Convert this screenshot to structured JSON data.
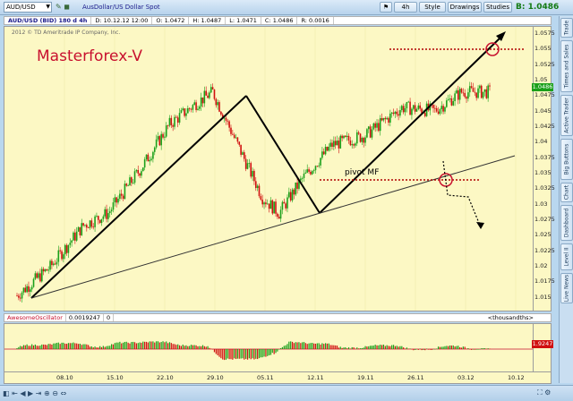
{
  "toolbar": {
    "symbol": "AUD/USD",
    "description": "AusDollar/US Dollar Spot",
    "period": "4h",
    "style": "Style",
    "drawings": "Drawings",
    "studies": "Studies",
    "bid": "B: 1.0486"
  },
  "chart_header": {
    "symbol_period": "AUD/USD (BID) 180 d 4h",
    "date": "D: 10.12.12 12:00",
    "open": "O: 1.0472",
    "high": "H: 1.0487",
    "low": "L: 1.0471",
    "close": "C: 1.0486",
    "range": "R: 0.0016"
  },
  "chart": {
    "watermark": "2012 © TD Ameritrade IP Company, Inc.",
    "title_annotation": "Masterforex-V",
    "pivot_label": "pivot MF",
    "last_price_label": "1.0486",
    "colors": {
      "up": "#1aa01a",
      "down": "#d01010",
      "accent_red": "#c8102e",
      "background": "#fcf8c4"
    }
  },
  "chart_data": {
    "type": "candlestick",
    "price_axis": [
      "1.0575",
      "1.055",
      "1.0525",
      "1.05",
      "1.0475",
      "1.045",
      "1.0425",
      "1.04",
      "1.0375",
      "1.035",
      "1.0325",
      "1.03",
      "1.0275",
      "1.025",
      "1.0225",
      "1.02",
      "1.0175",
      "1.015"
    ],
    "time_axis": [
      "08.10",
      "15.10",
      "22.10",
      "29.10",
      "05.11",
      "12.11",
      "19.11",
      "26.11",
      "03.12",
      "10.12"
    ],
    "ylim": [
      1.0125,
      1.0585
    ],
    "anchors": [
      {
        "x": 0,
        "y": 1.0152
      },
      {
        "x": 20,
        "y": 1.0198
      },
      {
        "x": 40,
        "y": 1.0265
      },
      {
        "x": 55,
        "y": 1.0285
      },
      {
        "x": 75,
        "y": 1.0358
      },
      {
        "x": 92,
        "y": 1.0428
      },
      {
        "x": 108,
        "y": 1.0462
      },
      {
        "x": 118,
        "y": 1.048
      },
      {
        "x": 133,
        "y": 1.0395
      },
      {
        "x": 148,
        "y": 1.031
      },
      {
        "x": 158,
        "y": 1.0285
      },
      {
        "x": 172,
        "y": 1.034
      },
      {
        "x": 190,
        "y": 1.0395
      },
      {
        "x": 210,
        "y": 1.041
      },
      {
        "x": 232,
        "y": 1.0455
      },
      {
        "x": 252,
        "y": 1.045
      },
      {
        "x": 268,
        "y": 1.048
      },
      {
        "x": 285,
        "y": 1.048
      }
    ]
  },
  "oscillator": {
    "name": "AwesomeOscillator",
    "value": "0.0019247",
    "param": "0",
    "units": "<thousandths>",
    "axis_label": "1.9247"
  },
  "side_tabs": [
    "Trade",
    "Times and Sales",
    "Active Trader",
    "Big Buttons",
    "Chart",
    "Dashboard",
    "Level II",
    "Live News"
  ]
}
